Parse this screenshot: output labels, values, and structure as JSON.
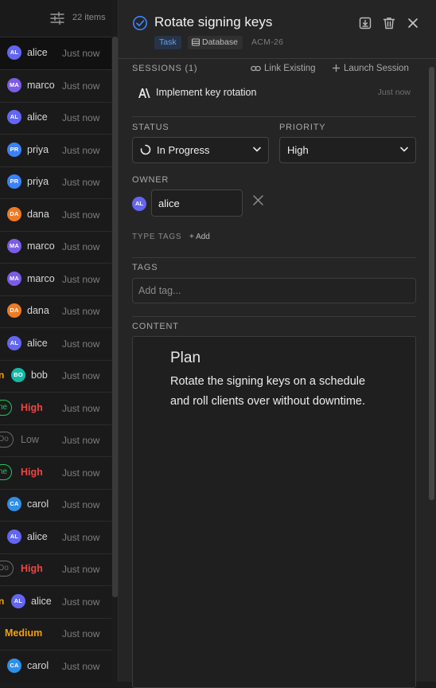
{
  "list": {
    "items_count": "22 items",
    "rows": [
      {
        "kind": "user",
        "initials": "AL",
        "name": "alice",
        "color": "#6366f1",
        "time": "Just now",
        "selected": true
      },
      {
        "kind": "user",
        "initials": "MA",
        "name": "marco",
        "color": "#7c5ce6",
        "time": "Just now"
      },
      {
        "kind": "user",
        "initials": "AL",
        "name": "alice",
        "color": "#6366f1",
        "time": "Just now"
      },
      {
        "kind": "user",
        "initials": "PR",
        "name": "priya",
        "color": "#3b82f6",
        "time": "Just now"
      },
      {
        "kind": "user",
        "initials": "PR",
        "name": "priya",
        "color": "#3b82f6",
        "time": "Just now"
      },
      {
        "kind": "user",
        "initials": "DA",
        "name": "dana",
        "color": "#f07a23",
        "time": "Just now"
      },
      {
        "kind": "user",
        "initials": "MA",
        "name": "marco",
        "color": "#7c5ce6",
        "time": "Just now"
      },
      {
        "kind": "user",
        "initials": "MA",
        "name": "marco",
        "color": "#7c5ce6",
        "time": "Just now"
      },
      {
        "kind": "user",
        "initials": "DA",
        "name": "dana",
        "color": "#f07a23",
        "time": "Just now"
      },
      {
        "kind": "user",
        "initials": "AL",
        "name": "alice",
        "color": "#6366f1",
        "time": "Just now"
      },
      {
        "kind": "user",
        "initials": "BO",
        "name": "bob",
        "color": "#14b8a6",
        "time": "Just now",
        "clip": "n",
        "clip_color": "#f59e0b"
      },
      {
        "kind": "prio",
        "pill": "ne",
        "pill_color": "#22c55e",
        "priority": "High",
        "prio_color": "#ef4444",
        "time": "Just now"
      },
      {
        "kind": "prio",
        "pill": "Do",
        "pill_color": "#6b6b6b",
        "priority": "Low",
        "prio_color": "#7a7a7a",
        "time": "Just now"
      },
      {
        "kind": "prio",
        "pill": "ne",
        "pill_color": "#22c55e",
        "priority": "High",
        "prio_color": "#ef4444",
        "time": "Just now"
      },
      {
        "kind": "user",
        "initials": "CA",
        "name": "carol",
        "color": "#2f8fe6",
        "time": "Just now"
      },
      {
        "kind": "user",
        "initials": "AL",
        "name": "alice",
        "color": "#6366f1",
        "time": "Just now"
      },
      {
        "kind": "prio",
        "pill": "Do",
        "pill_color": "#6b6b6b",
        "priority": "High",
        "prio_color": "#ef4444",
        "time": "Just now"
      },
      {
        "kind": "user",
        "initials": "AL",
        "name": "alice",
        "color": "#6366f1",
        "time": "Just now",
        "clip": "n",
        "clip_color": "#f59e0b"
      },
      {
        "kind": "prio",
        "priority": "Medium",
        "prio_color": "#f59e0b",
        "time": "Just now"
      },
      {
        "kind": "user",
        "initials": "CA",
        "name": "carol",
        "color": "#2f8fe6",
        "time": "Just now"
      }
    ]
  },
  "detail": {
    "title": "Rotate signing keys",
    "type": "Task",
    "database": "Database",
    "id": "ACM-26",
    "sessions_label": "SESSIONS (1)",
    "link_existing": "Link Existing",
    "launch_session": "Launch Session",
    "session": {
      "name": "Implement key rotation",
      "time": "Just now"
    },
    "status_label": "STATUS",
    "status_value": "In Progress",
    "priority_label": "PRIORITY",
    "priority_value": "High",
    "owner_label": "OWNER",
    "owner": {
      "initials": "AL",
      "name": "alice"
    },
    "type_tags_label": "TYPE TAGS",
    "add_type_tag": "+ Add",
    "tags_label": "TAGS",
    "tags_placeholder": "Add tag...",
    "content_label": "CONTENT",
    "content": {
      "heading": "Plan",
      "lines": [
        "Rotate the signing keys on a schedule",
        "and roll clients over without downtime."
      ]
    }
  },
  "colors": {
    "accent": "#3b82f6",
    "priority_high": "#ef4444",
    "priority_medium": "#f59e0b"
  }
}
